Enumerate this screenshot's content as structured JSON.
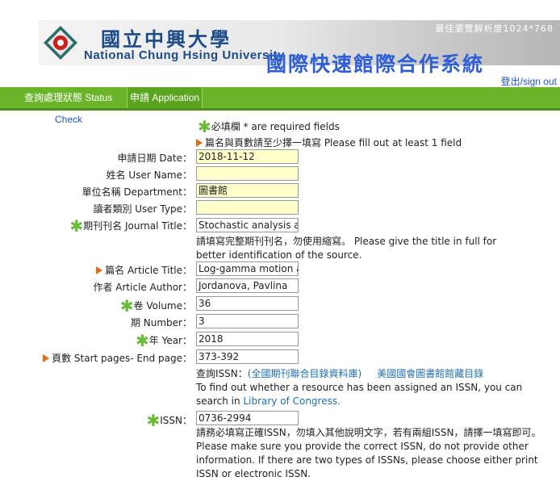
{
  "header": {
    "university_cn": "國立中興大學",
    "university_en": "National Chung Hsing University",
    "system_title": "國際快速館際合作系統",
    "resolution_note": "最佳瀏覽解析度1024*768",
    "signout": "登出/sign out"
  },
  "nav": {
    "status": "查詢處理狀態 Status",
    "apply": "申請 Application"
  },
  "check_link": "Check",
  "notes": {
    "required": "必填欄 * are required fields",
    "fill_one": "篇名與頁數請至少擇一填寫 Please fill out at least 1 field"
  },
  "form": {
    "date": {
      "label": "申請日期 Date：",
      "value": "2018-11-12"
    },
    "name": {
      "label": "姓名 User Name：",
      "value": ""
    },
    "department": {
      "label": "單位名稱 Department：",
      "value": "圖書館"
    },
    "user_type": {
      "label": "讀者類別 User Type：",
      "value": ""
    },
    "journal": {
      "label": "期刊刊名 Journal Title：",
      "value": "Stochastic analysis and",
      "hint": "請填寫完整期刊刊名，勿使用縮寫。 Please give the title in full for better identification of the source."
    },
    "article": {
      "label": "篇名 Article Title：",
      "value": "Log-gamma motion as"
    },
    "author": {
      "label": "作者 Article Author：",
      "value": "Jordanova, Pavlina"
    },
    "volume": {
      "label": "卷 Volume：",
      "value": "36"
    },
    "number": {
      "label": "期 Number：",
      "value": "3"
    },
    "year": {
      "label": "年 Year：",
      "value": "2018"
    },
    "pages": {
      "label": "頁數 Start pages- End page：",
      "value": "373-392"
    },
    "issn_lookup": {
      "prefix": "查詢ISSN：",
      "link1": "(全國期刊聯合目錄資料庫)",
      "link2": "美國國會圖書館館藏目錄",
      "text_en": "To find out whether a resource has been assigned an ISSN, you can search in",
      "link_loc": "Library of Congress."
    },
    "issn": {
      "label": "ISSN：",
      "value": "0736-2994",
      "hint": "請務必填寫正確ISSN，勿填入其他說明文字，若有兩組ISSN，請擇一填寫即可。 Please make sure you provide the correct ISSN, do not provide other information. If there are two types of ISSNs, please choose either print ISSN or electronic ISSN."
    }
  },
  "colors": {
    "nav_green": "#6ab42a",
    "title_blue": "#2f5fd6",
    "required_star": "#66bb33",
    "marker_orange": "#e06d1a",
    "input_yellow": "#ffffcc"
  },
  "icons": {
    "required": "star-icon",
    "fill_one": "orange-triangle-icon",
    "logo": "university-seal-icon"
  }
}
